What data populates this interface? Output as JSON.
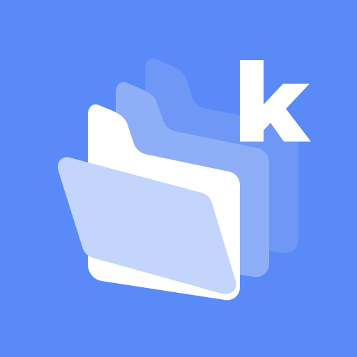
{
  "logo": {
    "mark_letter": "k",
    "icon": "stacked-folders-icon"
  },
  "colors": {
    "background": "#5a8af8",
    "folder_back": "#6e97f6",
    "folder_middle": "#8eaef8",
    "folder_front": "#ffffff",
    "folder_flap": "#c4d5fb",
    "letter": "#ffffff"
  }
}
